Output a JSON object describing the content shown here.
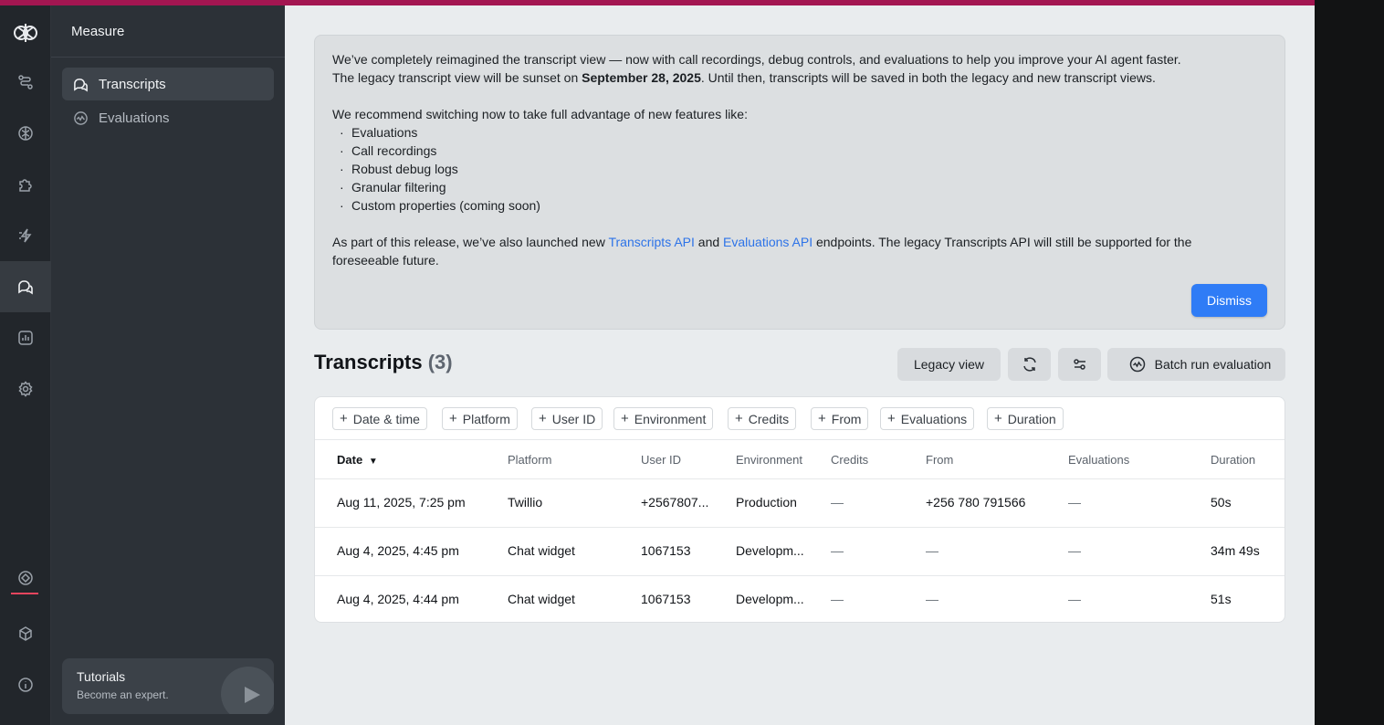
{
  "sidebar": {
    "section_title": "Measure",
    "items": [
      {
        "label": "Transcripts",
        "icon": "chat-bubbles-icon",
        "active": true
      },
      {
        "label": "Evaluations",
        "icon": "pulse-circle-icon",
        "active": false
      }
    ],
    "tutorial": {
      "title": "Tutorials",
      "subtitle": "Become an expert."
    }
  },
  "rail": {
    "icons": [
      "logo-icon",
      "flow-icon",
      "brain-icon",
      "puzzle-icon",
      "lightning-icon",
      "chat-bubbles-icon",
      "chart-icon",
      "gear-icon",
      "target-icon",
      "cube-icon",
      "info-icon"
    ]
  },
  "banner": {
    "line1": "We’ve completely reimagined the transcript view — now with call recordings, debug controls, and evaluations to help you improve your AI agent faster.",
    "line2_prefix": "The legacy transcript view will be sunset on ",
    "line2_date": "September 28, 2025",
    "line2_suffix": ". Until then, transcripts will be saved in both the legacy and new transcript views.",
    "recommend": "We recommend switching now to take full advantage of new features like:",
    "features": [
      "Evaluations",
      "Call recordings",
      "Robust debug logs",
      "Granular filtering",
      "Custom properties (coming soon)"
    ],
    "api_prefix": "As part of this release, we’ve also launched new ",
    "api_link1": "Transcripts API",
    "api_and": " and ",
    "api_link2": "Evaluations API",
    "api_suffix": " endpoints. The legacy Transcripts API will still be supported for the",
    "api_line2": "foreseeable future.",
    "dismiss": "Dismiss"
  },
  "list": {
    "title": "Transcripts",
    "count": "(3)",
    "legacy_view": "Legacy view",
    "batch_run": "Batch run evaluation"
  },
  "filters": [
    "Date & time",
    "Platform",
    "User ID",
    "Environment",
    "Credits",
    "From",
    "Evaluations",
    "Duration"
  ],
  "columns": [
    "Date",
    "Platform",
    "User ID",
    "Environment",
    "Credits",
    "From",
    "Evaluations",
    "Duration"
  ],
  "rows": [
    {
      "date": "Aug 11, 2025, 7:25 pm",
      "platform": "Twillio",
      "user_id": "+2567807...",
      "environment": "Production",
      "credits": "—",
      "from": "+256 780 791566",
      "evaluations": "—",
      "duration": "50s"
    },
    {
      "date": "Aug 4, 2025, 4:45 pm",
      "platform": "Chat widget",
      "user_id": "1067153",
      "environment": "Developm...",
      "credits": "—",
      "from": "—",
      "evaluations": "—",
      "duration": "34m 49s"
    },
    {
      "date": "Aug 4, 2025, 4:44 pm",
      "platform": "Chat widget",
      "user_id": "1067153",
      "environment": "Developm...",
      "credits": "—",
      "from": "—",
      "evaluations": "—",
      "duration": "51s"
    }
  ],
  "colors": {
    "accent_bar": "#a31651",
    "primary": "#2f7cf6",
    "link": "#2d73e8"
  }
}
